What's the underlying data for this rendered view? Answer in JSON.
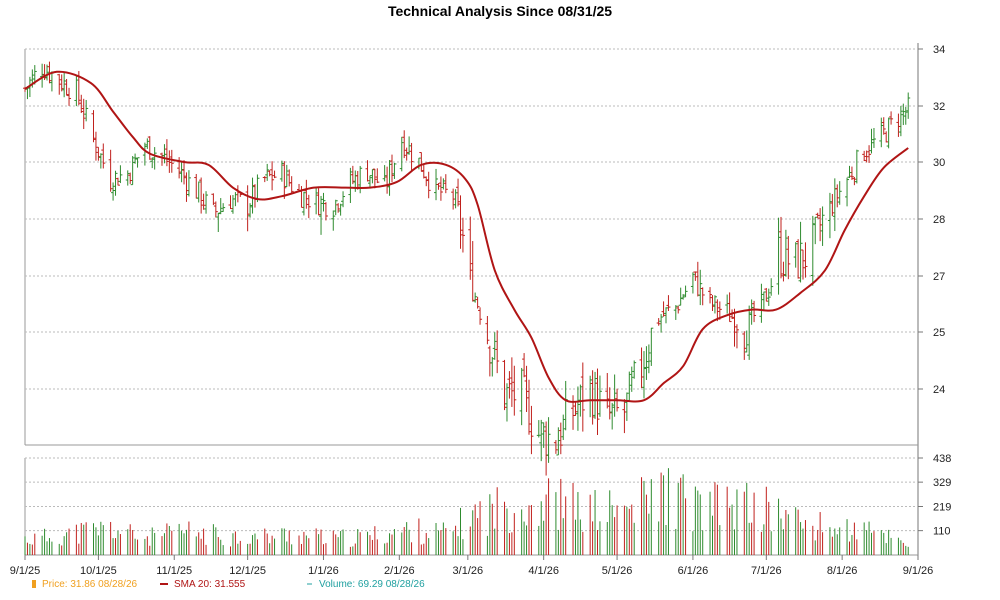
{
  "chart_data": {
    "type": "ohlc",
    "title": "Technical Analysis Since 08/31/25",
    "x_ticks": [
      {
        "date": "2025-09-01",
        "label": "9/1/25"
      },
      {
        "date": "2025-10-01",
        "label": "10/1/25"
      },
      {
        "date": "2025-11-01",
        "label": "11/1/25"
      },
      {
        "date": "2025-12-01",
        "label": "12/1/25"
      },
      {
        "date": "2026-01-01",
        "label": "1/1/26"
      },
      {
        "date": "2026-02-01",
        "label": "2/1/26"
      },
      {
        "date": "2026-03-01",
        "label": "3/1/26"
      },
      {
        "date": "2026-04-01",
        "label": "4/1/26"
      },
      {
        "date": "2026-05-01",
        "label": "5/1/26"
      },
      {
        "date": "2026-06-01",
        "label": "6/1/26"
      },
      {
        "date": "2026-07-01",
        "label": "7/1/26"
      },
      {
        "date": "2026-08-01",
        "label": "8/1/26"
      },
      {
        "date": "2026-09-01",
        "label": "9/1/26"
      }
    ],
    "x_range": [
      "2025-09-01",
      "2026-09-01"
    ],
    "price_axis": {
      "ticks": [
        {
          "v": 24,
          "label": "24"
        },
        {
          "v": 25,
          "label": "25"
        },
        {
          "v": 27,
          "label": "27"
        },
        {
          "v": 28,
          "label": "28"
        },
        {
          "v": 30,
          "label": "30"
        },
        {
          "v": 32,
          "label": "32"
        },
        {
          "v": 34,
          "label": "34"
        }
      ]
    },
    "volume_axis": {
      "ticks": [
        {
          "v": 110,
          "label": "110"
        },
        {
          "v": 219,
          "label": "219"
        },
        {
          "v": 329,
          "label": "329"
        },
        {
          "v": 438,
          "label": "438"
        }
      ]
    },
    "colors": {
      "up": "#2e8b2e",
      "down": "#c0201c",
      "sma": "#b01515",
      "grid": "#bbbbbb"
    },
    "price_series": [
      {
        "date": "2025-09-01",
        "close": 32.6
      },
      {
        "date": "2025-09-08",
        "close": 33.4
      },
      {
        "date": "2025-09-15",
        "close": 32.9
      },
      {
        "date": "2025-09-22",
        "close": 32.5
      },
      {
        "date": "2025-09-29",
        "close": 30.8
      },
      {
        "date": "2025-10-06",
        "close": 29.4
      },
      {
        "date": "2025-10-13",
        "close": 29.6
      },
      {
        "date": "2025-10-20",
        "close": 30.6
      },
      {
        "date": "2025-10-27",
        "close": 30.2
      },
      {
        "date": "2025-11-03",
        "close": 29.7
      },
      {
        "date": "2025-11-10",
        "close": 29.0
      },
      {
        "date": "2025-11-17",
        "close": 28.2
      },
      {
        "date": "2025-11-24",
        "close": 28.7
      },
      {
        "date": "2025-12-01",
        "close": 28.5
      },
      {
        "date": "2025-12-08",
        "close": 29.4
      },
      {
        "date": "2025-12-15",
        "close": 29.6
      },
      {
        "date": "2025-12-22",
        "close": 28.9
      },
      {
        "date": "2025-12-29",
        "close": 28.6
      },
      {
        "date": "2026-01-05",
        "close": 28.5
      },
      {
        "date": "2026-01-12",
        "close": 29.3
      },
      {
        "date": "2026-01-19",
        "close": 29.7
      },
      {
        "date": "2026-01-26",
        "close": 29.1
      },
      {
        "date": "2026-02-02",
        "close": 30.8
      },
      {
        "date": "2026-02-09",
        "close": 30.0
      },
      {
        "date": "2026-02-16",
        "close": 29.0
      },
      {
        "date": "2026-02-23",
        "close": 28.8
      },
      {
        "date": "2026-03-02",
        "close": 26.8
      },
      {
        "date": "2026-03-09",
        "close": 25.0
      },
      {
        "date": "2026-03-16",
        "close": 23.9
      },
      {
        "date": "2026-03-23",
        "close": 23.9
      },
      {
        "date": "2026-03-30",
        "close": 23.2
      },
      {
        "date": "2026-04-06",
        "close": 23.1
      },
      {
        "date": "2026-04-13",
        "close": 23.6
      },
      {
        "date": "2026-04-20",
        "close": 24.0
      },
      {
        "date": "2026-04-27",
        "close": 23.5
      },
      {
        "date": "2026-05-04",
        "close": 23.6
      },
      {
        "date": "2026-05-11",
        "close": 24.4
      },
      {
        "date": "2026-05-18",
        "close": 25.5
      },
      {
        "date": "2026-05-25",
        "close": 25.9
      },
      {
        "date": "2026-06-01",
        "close": 26.9
      },
      {
        "date": "2026-06-08",
        "close": 26.0
      },
      {
        "date": "2026-06-15",
        "close": 25.7
      },
      {
        "date": "2026-06-22",
        "close": 25.1
      },
      {
        "date": "2026-06-29",
        "close": 25.9
      },
      {
        "date": "2026-07-06",
        "close": 27.4
      },
      {
        "date": "2026-07-13",
        "close": 27.2
      },
      {
        "date": "2026-07-20",
        "close": 27.5
      },
      {
        "date": "2026-07-27",
        "close": 28.4
      },
      {
        "date": "2026-08-03",
        "close": 29.4
      },
      {
        "date": "2026-08-10",
        "close": 30.4
      },
      {
        "date": "2026-08-17",
        "close": 30.9
      },
      {
        "date": "2026-08-24",
        "close": 31.6
      },
      {
        "date": "2026-08-28",
        "close": 31.86
      }
    ],
    "sma_series": [
      {
        "date": "2025-09-01",
        "v": 32.6
      },
      {
        "date": "2025-09-14",
        "v": 33.2
      },
      {
        "date": "2025-09-28",
        "v": 32.8
      },
      {
        "date": "2025-10-07",
        "v": 31.8
      },
      {
        "date": "2025-10-15",
        "v": 30.9
      },
      {
        "date": "2025-10-22",
        "v": 30.3
      },
      {
        "date": "2025-11-05",
        "v": 30.0
      },
      {
        "date": "2025-11-15",
        "v": 29.9
      },
      {
        "date": "2025-11-25",
        "v": 29.1
      },
      {
        "date": "2025-12-05",
        "v": 28.7
      },
      {
        "date": "2025-12-15",
        "v": 28.8
      },
      {
        "date": "2025-12-28",
        "v": 29.1
      },
      {
        "date": "2026-01-10",
        "v": 29.1
      },
      {
        "date": "2026-01-20",
        "v": 29.1
      },
      {
        "date": "2026-01-31",
        "v": 29.3
      },
      {
        "date": "2026-02-10",
        "v": 29.9
      },
      {
        "date": "2026-02-20",
        "v": 29.9
      },
      {
        "date": "2026-02-28",
        "v": 29.4
      },
      {
        "date": "2026-03-05",
        "v": 28.5
      },
      {
        "date": "2026-03-12",
        "v": 27.1
      },
      {
        "date": "2026-03-20",
        "v": 25.8
      },
      {
        "date": "2026-03-27",
        "v": 24.9
      },
      {
        "date": "2026-04-03",
        "v": 24.2
      },
      {
        "date": "2026-04-10",
        "v": 23.8
      },
      {
        "date": "2026-04-20",
        "v": 23.8
      },
      {
        "date": "2026-05-01",
        "v": 23.8
      },
      {
        "date": "2026-05-12",
        "v": 23.8
      },
      {
        "date": "2026-05-20",
        "v": 24.1
      },
      {
        "date": "2026-05-28",
        "v": 24.4
      },
      {
        "date": "2026-06-05",
        "v": 25.1
      },
      {
        "date": "2026-06-15",
        "v": 25.6
      },
      {
        "date": "2026-06-25",
        "v": 25.8
      },
      {
        "date": "2026-07-05",
        "v": 25.8
      },
      {
        "date": "2026-07-15",
        "v": 26.4
      },
      {
        "date": "2026-07-25",
        "v": 27.1
      },
      {
        "date": "2026-08-02",
        "v": 27.8
      },
      {
        "date": "2026-08-10",
        "v": 28.8
      },
      {
        "date": "2026-08-18",
        "v": 29.8
      },
      {
        "date": "2026-08-28",
        "v": 30.5
      }
    ],
    "volume_series": [
      {
        "date": "2025-09-05",
        "v": 90
      },
      {
        "date": "2025-09-20",
        "v": 120
      },
      {
        "date": "2025-10-05",
        "v": 150
      },
      {
        "date": "2025-10-20",
        "v": 95
      },
      {
        "date": "2025-11-05",
        "v": 130
      },
      {
        "date": "2025-11-20",
        "v": 110
      },
      {
        "date": "2025-12-05",
        "v": 100
      },
      {
        "date": "2025-12-20",
        "v": 115
      },
      {
        "date": "2026-01-05",
        "v": 90
      },
      {
        "date": "2026-01-20",
        "v": 105
      },
      {
        "date": "2026-02-05",
        "v": 140
      },
      {
        "date": "2026-02-20",
        "v": 120
      },
      {
        "date": "2026-03-05",
        "v": 230
      },
      {
        "date": "2026-03-20",
        "v": 280
      },
      {
        "date": "2026-04-05",
        "v": 300
      },
      {
        "date": "2026-04-20",
        "v": 240
      },
      {
        "date": "2026-05-05",
        "v": 250
      },
      {
        "date": "2026-05-20",
        "v": 350
      },
      {
        "date": "2026-06-05",
        "v": 260
      },
      {
        "date": "2026-06-20",
        "v": 280
      },
      {
        "date": "2026-07-05",
        "v": 240
      },
      {
        "date": "2026-07-20",
        "v": 160
      },
      {
        "date": "2026-08-05",
        "v": 140
      },
      {
        "date": "2026-08-20",
        "v": 110
      },
      {
        "date": "2026-08-28",
        "v": 69.29
      }
    ]
  },
  "legend": [
    {
      "marker": "bar",
      "color": "#f0a020",
      "text": "Price: 31.86  08/28/26"
    },
    {
      "marker": "line",
      "color": "#b01515",
      "text": "SMA 20: 31.555"
    },
    {
      "marker": "dash",
      "color": "#20a0a0",
      "text": "Volume: 69.29  08/28/26"
    }
  ]
}
